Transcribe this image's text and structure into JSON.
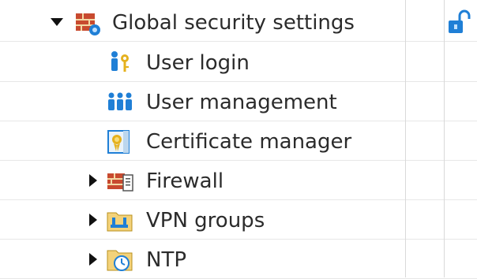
{
  "tree": {
    "items": [
      {
        "label": "Global security settings",
        "icon": "security-settings-icon",
        "expanded": true,
        "level": 0
      },
      {
        "label": "User login",
        "icon": "user-login-icon",
        "expanded": null,
        "level": 1
      },
      {
        "label": "User management",
        "icon": "user-management-icon",
        "expanded": null,
        "level": 1
      },
      {
        "label": "Certificate manager",
        "icon": "certificate-icon",
        "expanded": null,
        "level": 1
      },
      {
        "label": "Firewall",
        "icon": "firewall-icon",
        "expanded": false,
        "level": 1
      },
      {
        "label": "VPN groups",
        "icon": "vpn-groups-icon",
        "expanded": false,
        "level": 1
      },
      {
        "label": "NTP",
        "icon": "ntp-icon",
        "expanded": false,
        "level": 1
      }
    ]
  },
  "status": {
    "lock_icon": "unlocked-padlock-icon"
  },
  "colors": {
    "text": "#2b2b2b",
    "accent_blue": "#1f7fd6",
    "gold": "#e5b11e",
    "brick": "#c0392b"
  }
}
